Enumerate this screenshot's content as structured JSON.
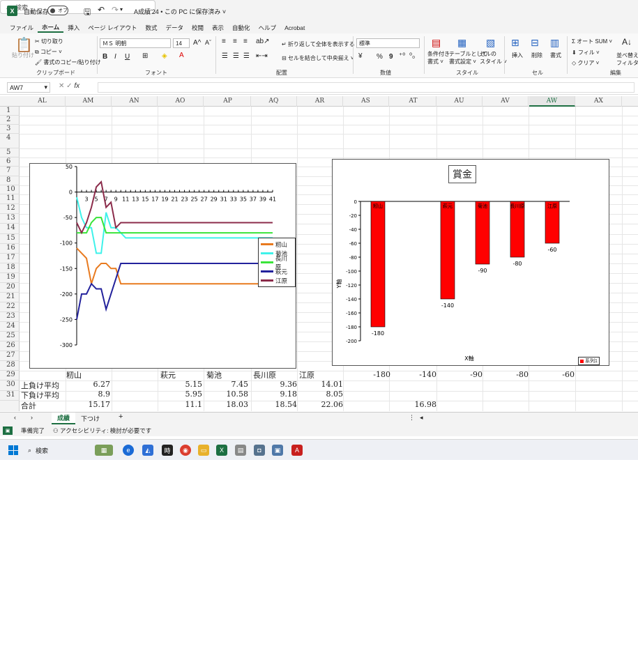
{
  "titlebar": {
    "excel_logo": "X",
    "autosave_label": "自動保存",
    "autosave_state": "オフ",
    "doc_title": "A成績'24 • この PC に保存済み ˅",
    "search_placeholder": "検索"
  },
  "menu": [
    "ファイル",
    "ホーム",
    "挿入",
    "ページ レイアウト",
    "数式",
    "データ",
    "校閲",
    "表示",
    "自動化",
    "ヘルプ",
    "Acrobat"
  ],
  "menu_active": "ホーム",
  "ribbon": {
    "paste": "貼り付け",
    "cut": "切り取り",
    "copy": "コピー ˅",
    "format_painter": "書式のコピー/貼り付け",
    "clipboard_label": "クリップボード",
    "font_name": "ＭＳ 明朝",
    "font_size": "14",
    "grow_font": "A^",
    "shrink_font": "Aˇ",
    "bold": "B",
    "italic": "I",
    "underline": "U",
    "font_label": "フォント",
    "wrap_text": "折り返して全体を表示する",
    "merge_center": "セルを結合して中央揃え ˅",
    "alignment_label": "配置",
    "number_format": "標準",
    "percent": "%",
    "comma": "9",
    "number_label": "数値",
    "conditional": [
      "条件付き",
      "書式 ˅"
    ],
    "format_table": [
      "テーブルとして",
      "書式設定 ˅"
    ],
    "cell_style": [
      "セルの",
      "スタイル ˅"
    ],
    "styles_label": "スタイル",
    "insert": "挿入",
    "delete": "削除",
    "format": "書式",
    "cells_label": "セル",
    "autosum": "Σ オート SUM ˅",
    "fill": "フィル ˅",
    "clear": "クリア ˅",
    "sort": [
      "並べ替え",
      "フィルター"
    ],
    "editing_label": "編集"
  },
  "formula_bar": {
    "name_box": "AW7",
    "fx": "fx",
    "value": ""
  },
  "columns": [
    "AL",
    "AM",
    "AN",
    "AO",
    "AP",
    "AQ",
    "AR",
    "AS",
    "AT",
    "AU",
    "AV",
    "AW",
    "AX"
  ],
  "selected_column": "AW",
  "rows": [
    "1",
    "2",
    "3",
    "4",
    "5",
    "6",
    "7",
    "8",
    "10",
    "11",
    "12",
    "13",
    "14",
    "15",
    "16",
    "17",
    "18",
    "19",
    "20",
    "21",
    "22",
    "23",
    "24",
    "25",
    "26",
    "27",
    "28",
    "29",
    "30",
    "31"
  ],
  "cells": {
    "row28": {
      "name_kashiyama": "籾山",
      "name_hagimoto": "萩元",
      "name_kikuchi": "菊池",
      "name_hasegawara": "長川原",
      "name_ebara": "江原",
      "v1": "-180",
      "v2": "-140",
      "v3": "-90",
      "v4": "-80",
      "v5": "-60"
    },
    "row29": {
      "label": "上負け平均",
      "a": "6.27",
      "b": "5.15",
      "c": "7.45",
      "d": "9.36",
      "e": "14.01"
    },
    "row30": {
      "label": "下負け平均",
      "a": "8.9",
      "b": "5.95",
      "c": "10.58",
      "d": "9.18",
      "e": "8.05"
    },
    "row31": {
      "label": "合計",
      "a": "15.17",
      "b": "11.1",
      "c": "18.03",
      "d": "18.54",
      "e": "22.06",
      "f": "16.98"
    }
  },
  "chart_data": [
    {
      "type": "line",
      "title": "",
      "x": [
        1,
        2,
        3,
        4,
        5,
        6,
        7,
        8,
        9,
        10,
        11,
        12,
        13,
        14,
        15,
        16,
        17,
        18,
        19,
        20,
        21,
        22,
        23,
        24,
        25,
        26,
        27,
        28,
        29,
        30,
        31,
        32,
        33,
        34,
        35,
        36,
        37,
        38,
        39,
        40,
        41
      ],
      "x_tick_labels": [
        "3",
        "5",
        "7",
        "9",
        "11",
        "13",
        "15",
        "17",
        "19",
        "21",
        "23",
        "25",
        "27",
        "29",
        "31",
        "33",
        "35",
        "37",
        "39",
        "41"
      ],
      "y_tick_labels": [
        "50",
        "0",
        "-50",
        "-100",
        "-150",
        "-200",
        "-250",
        "-300"
      ],
      "ylim": [
        -300,
        50
      ],
      "legend_position": "right",
      "series": [
        {
          "name": "籾山",
          "color": "#e87a1f",
          "values": [
            -110,
            -120,
            -130,
            -180,
            -150,
            -140,
            -140,
            -150,
            -150,
            -180,
            -180,
            -180,
            -180,
            -180,
            -180,
            -180,
            -180,
            -180,
            -180,
            -180,
            -180,
            -180,
            -180,
            -180,
            -180,
            -180,
            -180,
            -180,
            -180,
            -180,
            -180,
            -180,
            -180,
            -180,
            -180,
            -180,
            -180,
            -180,
            -180,
            -180,
            -180
          ]
        },
        {
          "name": "菊池",
          "color": "#3ff2ea",
          "values": [
            -10,
            -50,
            -70,
            -70,
            -120,
            -120,
            -40,
            -70,
            -70,
            -80,
            -90,
            -90,
            -90,
            -90,
            -90,
            -90,
            -90,
            -90,
            -90,
            -90,
            -90,
            -90,
            -90,
            -90,
            -90,
            -90,
            -90,
            -90,
            -90,
            -90,
            -90,
            -90,
            -90,
            -90,
            -90,
            -90,
            -90,
            -90,
            -90,
            -90,
            -90
          ]
        },
        {
          "name": "長川原",
          "color": "#3ae43a",
          "values": [
            -80,
            -80,
            -80,
            -60,
            -50,
            -50,
            -80,
            -80,
            -80,
            -80,
            -80,
            -80,
            -80,
            -80,
            -80,
            -80,
            -80,
            -80,
            -80,
            -80,
            -80,
            -80,
            -80,
            -80,
            -80,
            -80,
            -80,
            -80,
            -80,
            -80,
            -80,
            -80,
            -80,
            -80,
            -80,
            -80,
            -80,
            -80,
            -80,
            -80,
            -80
          ]
        },
        {
          "name": "萩元",
          "color": "#23229c",
          "values": [
            -250,
            -200,
            -200,
            -180,
            -190,
            -190,
            -230,
            -200,
            -170,
            -140,
            -140,
            -140,
            -140,
            -140,
            -140,
            -140,
            -140,
            -140,
            -140,
            -140,
            -140,
            -140,
            -140,
            -140,
            -140,
            -140,
            -140,
            -140,
            -140,
            -140,
            -140,
            -140,
            -140,
            -140,
            -140,
            -140,
            -140,
            -140,
            -140,
            -140,
            -140
          ]
        },
        {
          "name": "江原",
          "color": "#8b2b4a",
          "values": [
            -60,
            -80,
            -60,
            -30,
            10,
            20,
            -30,
            -20,
            -70,
            -60,
            -60,
            -60,
            -60,
            -60,
            -60,
            -60,
            -60,
            -60,
            -60,
            -60,
            -60,
            -60,
            -60,
            -60,
            -60,
            -60,
            -60,
            -60,
            -60,
            -60,
            -60,
            -60,
            -60,
            -60,
            -60,
            -60,
            -60,
            -60,
            -60,
            -60,
            -60
          ]
        }
      ]
    },
    {
      "type": "bar",
      "title": "賞金",
      "categories": [
        "籾山",
        "",
        "萩元",
        "菊池",
        "長川原",
        "江原"
      ],
      "values": [
        -180,
        null,
        -140,
        -90,
        -80,
        -60
      ],
      "data_labels": [
        "-180",
        "",
        "-140",
        "-90",
        "-80",
        "-60"
      ],
      "y_tick_labels": [
        "0",
        "-20",
        "-40",
        "-60",
        "-80",
        "-100",
        "-120",
        "-140",
        "-160",
        "-180",
        "-200"
      ],
      "ylim": [
        -200,
        0
      ],
      "xlabel": "X軸",
      "ylabel": "Y軸",
      "bar_color": "#ff0000",
      "legend": "系列1",
      "legend_position": "bottom-right"
    }
  ],
  "sheets": [
    "成績",
    "下つけ"
  ],
  "active_sheet": "成績",
  "add_sheet": "+",
  "status": {
    "ready": "準備完了",
    "accessibility": "アクセシビリティ: 検討が必要です"
  },
  "taskbar": {
    "search": "検索"
  }
}
